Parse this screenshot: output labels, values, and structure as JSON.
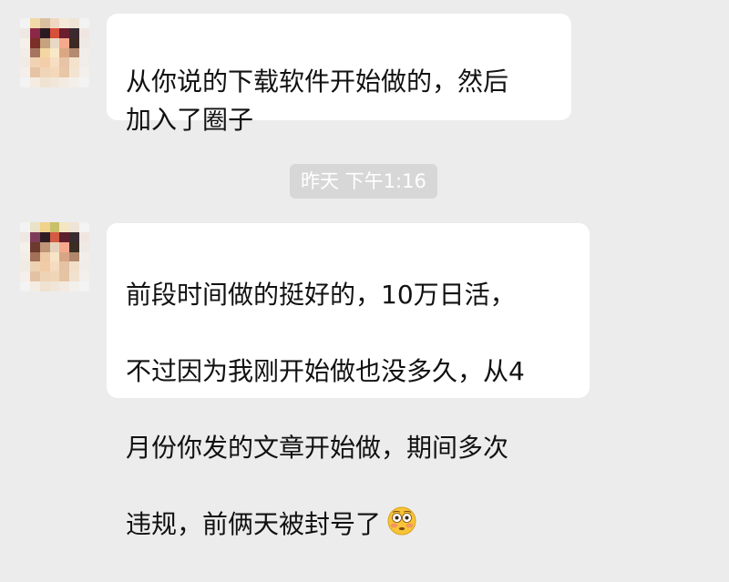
{
  "messages": [
    {
      "sender": "contact",
      "text": "从你说的下载软件开始做的，然后\n加入了圈子"
    },
    {
      "sender": "contact",
      "lines": [
        "前段时间做的挺好的，10万日活，",
        "不过因为我刚开始做也没多久，从4",
        "月份你发的文章开始做，期间多次",
        "违规，前俩天被封号了"
      ],
      "emoji": "flushed-face-emoji"
    }
  ],
  "timestamp": "昨天 下午1:16",
  "colors": {
    "background": "#ececec",
    "bubble": "#ffffff",
    "timestamp_bg": "#d7d7d7",
    "timestamp_text": "#ffffff"
  }
}
